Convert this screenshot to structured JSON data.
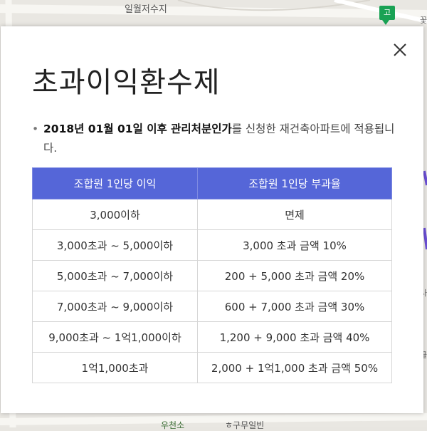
{
  "map": {
    "label_top": "일월저수지",
    "label_bottom_1": "우천소",
    "label_bottom_2": "ㅎ구무일빈",
    "badge": "고",
    "right_text_1": "꽃",
    "right_text_2": "사",
    "right_text_3": "클"
  },
  "modal": {
    "title": "초과이익환수제",
    "note": {
      "highlight": "2018년 01월 01일 이후 관리처분인가",
      "rest": "를 신청한 재건축아파트에 적용됩니다."
    },
    "table": {
      "headers": [
        "조합원 1인당 이익",
        "조합원 1인당 부과율"
      ],
      "rows": [
        [
          "3,000이하",
          "면제"
        ],
        [
          "3,000초과 ~ 5,000이하",
          "3,000 초과 금액 10%"
        ],
        [
          "5,000초과 ~ 7,000이하",
          "200 + 5,000 초과 금액 20%"
        ],
        [
          "7,000초과 ~ 9,000이하",
          "600 + 7,000 초과 금액 30%"
        ],
        [
          "9,000초과 ~ 1억1,000이하",
          "1,200 + 9,000 초과 금액 40%"
        ],
        [
          "1억1,000초과",
          "2,000 + 1억1,000 초과 금액 50%"
        ]
      ]
    }
  }
}
